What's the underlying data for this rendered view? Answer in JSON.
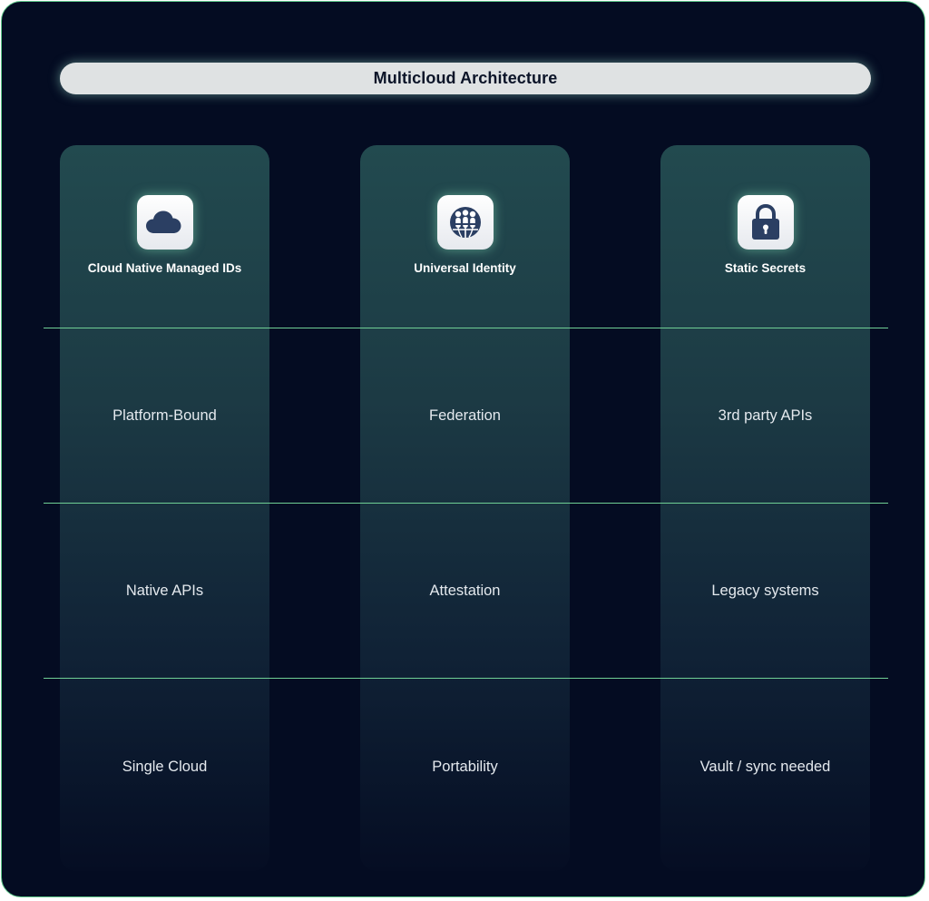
{
  "title": "Multicloud Architecture",
  "colors": {
    "background": "#040c22",
    "border": "#5fc98b",
    "divider": "#6fcf95",
    "column_top": "#224a4f",
    "icon_fill": "#2b3f63",
    "title_bar": "#dfe2e3"
  },
  "columns": [
    {
      "heading": "Cloud Native Managed IDs",
      "icon": "cloud-icon",
      "rows": [
        "Platform-Bound",
        "Native APIs",
        "Single Cloud"
      ]
    },
    {
      "heading": "Universal Identity",
      "icon": "globe-people-icon",
      "rows": [
        "Federation",
        "Attestation",
        "Portability"
      ]
    },
    {
      "heading": "Static Secrets",
      "icon": "lock-icon",
      "rows": [
        "3rd party APIs",
        "Legacy systems",
        "Vault / sync needed"
      ]
    }
  ]
}
